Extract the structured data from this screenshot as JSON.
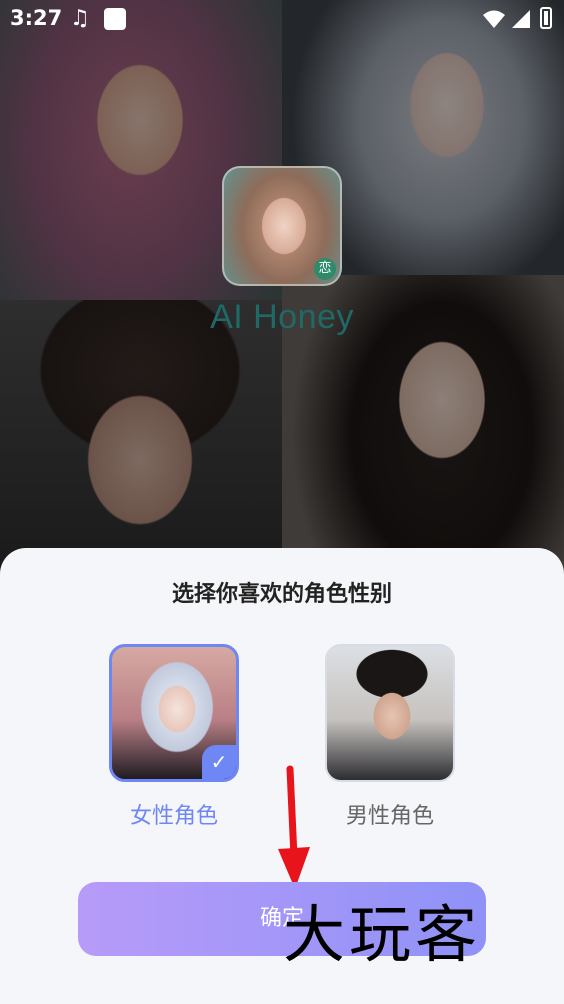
{
  "status_bar": {
    "time": "3:27"
  },
  "app": {
    "name": "AI Honey",
    "badge": "恋"
  },
  "sheet": {
    "title": "选择你喜欢的角色性别",
    "options": [
      {
        "label": "女性角色",
        "selected": true
      },
      {
        "label": "男性角色",
        "selected": false
      }
    ],
    "confirm_label": "确定"
  },
  "watermark": "大玩客",
  "colors": {
    "accent": "#6f86f5",
    "button_start": "#b79bf8",
    "button_end": "#8f92f7",
    "arrow": "#e8141b"
  }
}
